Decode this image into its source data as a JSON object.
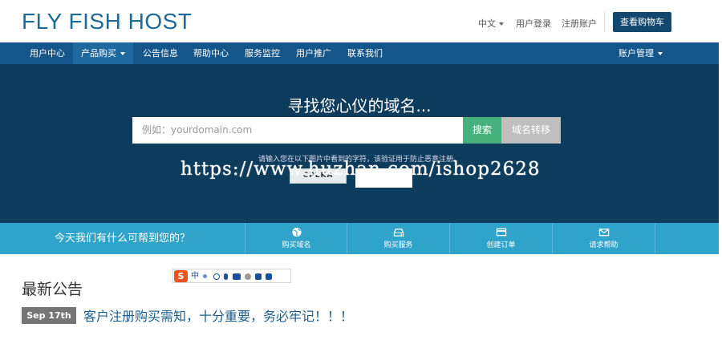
{
  "header": {
    "logo": "FLY FISH HOST",
    "language": "中文",
    "login": "用户登录",
    "register": "注册账户",
    "cart": "查看购物车"
  },
  "nav": {
    "items": [
      {
        "label": "用户中心"
      },
      {
        "label": "产品购买"
      },
      {
        "label": "公告信息"
      },
      {
        "label": "帮助中心"
      },
      {
        "label": "服务监控"
      },
      {
        "label": "用户推广"
      },
      {
        "label": "联系我们"
      }
    ],
    "account": "账户管理"
  },
  "hero": {
    "title": "寻找您心仪的域名...",
    "search_placeholder": "例如：yourdomain.com",
    "search_button": "搜索",
    "transfer_button": "域名转移",
    "captcha_note": "请输入您在以下图片中看到的字符，该验证用于防止恶意注册。",
    "captcha_text": "CPLKA"
  },
  "watermark": "https://www.huzhan.com/ishop2628",
  "help": {
    "text": "今天我们有什么可帮到您的？",
    "items": [
      {
        "label": "购买域名",
        "icon": "globe-icon"
      },
      {
        "label": "购买服务",
        "icon": "hdd-icon"
      },
      {
        "label": "创建订单",
        "icon": "credit-card-icon"
      },
      {
        "label": "请求帮助",
        "icon": "envelope-icon"
      }
    ]
  },
  "news": {
    "title": "最新公告",
    "date": "Sep 17th",
    "headline": "客户注册购买需知，十分重要，务必牢记！！！"
  },
  "ime": {
    "logo": "S",
    "mode": "中"
  },
  "colors": {
    "nav": "#15568a",
    "hero": "#0e3c5d",
    "search": "#47b17d",
    "help_band": "#2fa3c9",
    "cart": "#14476d"
  }
}
